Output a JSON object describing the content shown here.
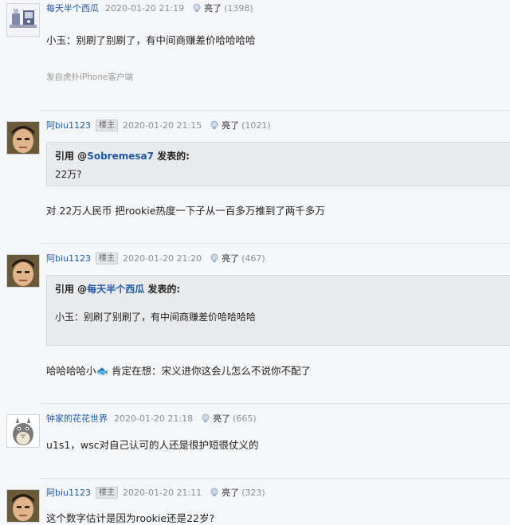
{
  "posts": [
    {
      "username": "每天半个西瓜",
      "is_op": false,
      "time": "2020-01-20 21:19",
      "light_label": "亮了",
      "light_count": "(1398)",
      "content": "小玉：别刷了别刷了，有中间商赚差价哈哈哈哈",
      "source": "发自虎扑iPhone客户端"
    },
    {
      "username": "阿biu1123",
      "is_op": true,
      "op_label": "楼主",
      "time": "2020-01-20 21:15",
      "light_label": "亮了",
      "light_count": "(1021)",
      "quote": {
        "prefix": "引用 @",
        "name": "Sobremesa7",
        "suffix": " 发表的:",
        "body": "22万?"
      },
      "content": "对 22万人民币 把rookie热度一下子从一百多万推到了两千多万"
    },
    {
      "username": "阿biu1123",
      "is_op": true,
      "op_label": "楼主",
      "time": "2020-01-20 21:20",
      "light_label": "亮了",
      "light_count": "(467)",
      "quote": {
        "prefix": "引用 @",
        "name": "每天半个西瓜",
        "suffix": " 发表的:",
        "body": "小玉：别刷了别刷了，有中间商赚差价哈哈哈哈"
      },
      "content": "哈哈哈哈小🐟 肯定在想：宋义进你这会儿怎么不说你不配了"
    },
    {
      "username": "钟家的花花世界",
      "is_op": false,
      "time": "2020-01-20 21:18",
      "light_label": "亮了",
      "light_count": "(665)",
      "content": "u1s1，wsc对自己认可的人还是很护短很仗义的"
    },
    {
      "username": "阿biu1123",
      "is_op": true,
      "op_label": "楼主",
      "time": "2020-01-20 21:11",
      "light_label": "亮了",
      "light_count": "(323)",
      "content": "这个数字估计是因为rookie还是22岁?"
    }
  ],
  "icons": {
    "light": "lightbulb-icon",
    "avatar_1": "cartoon-desk-avatar",
    "avatar_person": "person-photo-avatar",
    "avatar_totoro": "totoro-avatar"
  }
}
